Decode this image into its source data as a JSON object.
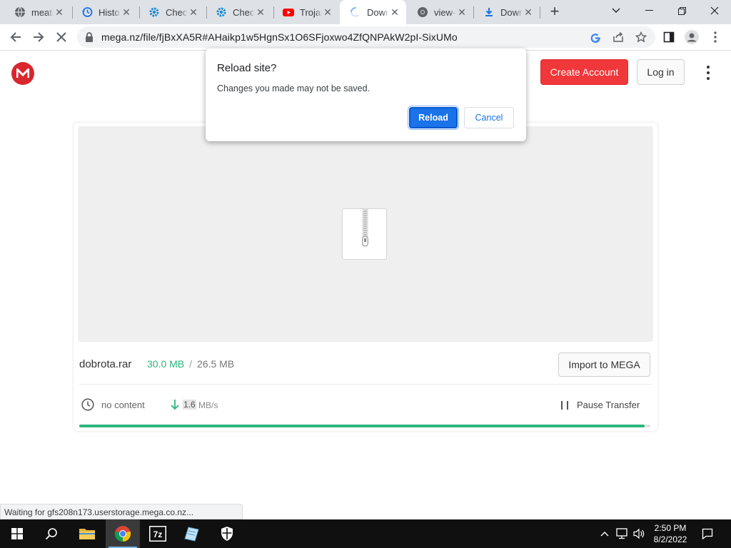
{
  "browser": {
    "tabs": [
      {
        "title": "meatr",
        "icon": "globe-icon"
      },
      {
        "title": "Histo",
        "icon": "history-icon"
      },
      {
        "title": "Check",
        "icon": "gear-icon"
      },
      {
        "title": "Check",
        "icon": "gear-icon"
      },
      {
        "title": "Trojan",
        "icon": "youtube-icon"
      },
      {
        "title": "Down",
        "icon": "loading-spinner-icon"
      },
      {
        "title": "view-",
        "icon": "chrome-icon"
      },
      {
        "title": "Down",
        "icon": "download-icon"
      }
    ],
    "active_tab_index": 5,
    "url": "mega.nz/file/fjBxXA5R#AHaikp1w5HgnSx1O6SFjoxwo4ZfQNPAkW2pI-SixUMo"
  },
  "dialog": {
    "title": "Reload site?",
    "message": "Changes you made may not be saved.",
    "reload_label": "Reload",
    "cancel_label": "Cancel"
  },
  "header": {
    "create_account": "Create Account",
    "login": "Log in"
  },
  "file": {
    "name": "dobrota.rar",
    "downloaded": "30.0 MB",
    "separator": "/",
    "total": "26.5 MB",
    "import_label": "Import to MEGA",
    "status": "no content",
    "speed_value": "1.6",
    "speed_unit": "MB/s",
    "pause_label": "Pause Transfer",
    "progress": 0.99
  },
  "status_bar": "Waiting for gfs208n173.userstorage.mega.co.nz...",
  "taskbar": {
    "time": "2:50 PM",
    "date": "8/2/2022"
  },
  "colors": {
    "mega_red": "#d9272e",
    "accent_green": "#2bb67d",
    "chrome_blue": "#1a73e8"
  }
}
